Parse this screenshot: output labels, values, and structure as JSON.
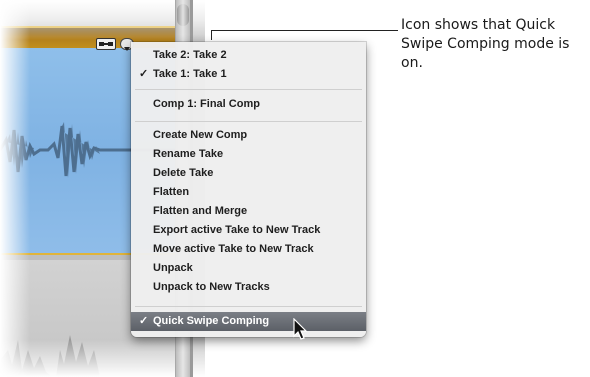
{
  "callout": {
    "line1": "Icon shows that Quick",
    "line2": "Swipe Comping mode is",
    "line3": "on."
  },
  "menu": {
    "check_mark": "✓",
    "items": [
      {
        "label": "Take 2: Take 2",
        "checked": false
      },
      {
        "label": "Take 1: Take 1",
        "checked": true
      },
      {
        "label": "Comp 1: Final Comp",
        "checked": false
      },
      {
        "label": "Create New Comp",
        "checked": false
      },
      {
        "label": "Rename Take",
        "checked": false
      },
      {
        "label": "Delete Take",
        "checked": false
      },
      {
        "label": "Flatten",
        "checked": false
      },
      {
        "label": "Flatten and Merge",
        "checked": false
      },
      {
        "label": "Export active Take to New Track",
        "checked": false
      },
      {
        "label": "Move active Take to New Track",
        "checked": false
      },
      {
        "label": "Unpack",
        "checked": false
      },
      {
        "label": "Unpack to New Tracks",
        "checked": false
      },
      {
        "label": "Quick Swipe Comping",
        "checked": true,
        "highlighted": true
      }
    ]
  },
  "icons": {
    "quick_swipe": "quick-swipe-comping-icon",
    "take_menu": "take-folder-menu-icon",
    "cursor": "mouse-pointer-icon"
  },
  "colors": {
    "region_blue": "#86b8e6",
    "take_border": "#e0b43a",
    "menu_highlight": "#6a6e75"
  }
}
